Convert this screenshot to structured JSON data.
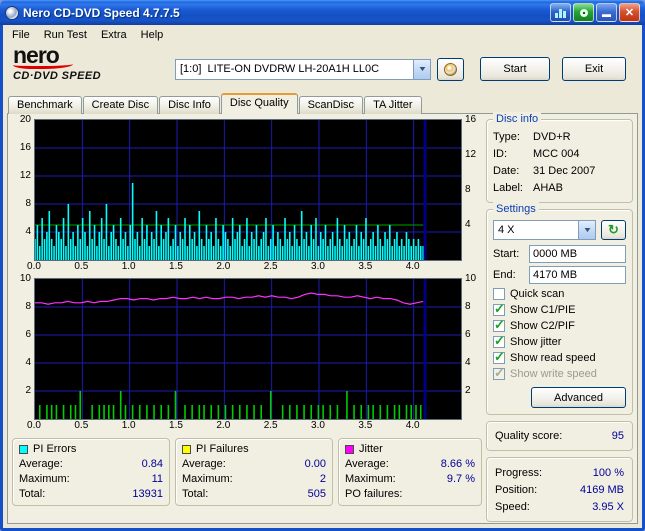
{
  "window": {
    "title": "Nero CD-DVD Speed 4.7.7.5"
  },
  "icons": {
    "minimize_glyph": "▬",
    "close_glyph": "✕",
    "refresh_glyph": "↻",
    "dropdown_glyph": "▼"
  },
  "menu": {
    "items": [
      "File",
      "Run Test",
      "Extra",
      "Help"
    ]
  },
  "logo": {
    "brand": "nero",
    "product": "CD·DVD SPEED"
  },
  "toolbar": {
    "drive_value": "[1:0]  LITE-ON DVDRW LH-20A1H LL0C",
    "start_label": "Start",
    "exit_label": "Exit"
  },
  "tabs": {
    "items": [
      {
        "label": "Benchmark"
      },
      {
        "label": "Create Disc"
      },
      {
        "label": "Disc Info"
      },
      {
        "label": "Disc Quality"
      },
      {
        "label": "ScanDisc"
      },
      {
        "label": "TA Jitter"
      }
    ],
    "active": "Disc Quality"
  },
  "disc_info": {
    "title": "Disc info",
    "rows": [
      {
        "label": "Type:",
        "value": "DVD+R"
      },
      {
        "label": "ID:",
        "value": "MCC 004"
      },
      {
        "label": "Date:",
        "value": "31 Dec 2007"
      },
      {
        "label": "Label:",
        "value": "AHAB"
      }
    ]
  },
  "settings": {
    "title": "Settings",
    "speed_value": "4 X",
    "start_label": "Start:",
    "start_value": "0000 MB",
    "end_label": "End:",
    "end_value": "4170 MB",
    "checkboxes": [
      {
        "label": "Quick scan",
        "checked": false,
        "enabled": true
      },
      {
        "label": "Show C1/PIE",
        "checked": true,
        "enabled": true
      },
      {
        "label": "Show C2/PIF",
        "checked": true,
        "enabled": true
      },
      {
        "label": "Show jitter",
        "checked": true,
        "enabled": true
      },
      {
        "label": "Show read speed",
        "checked": true,
        "enabled": true
      },
      {
        "label": "Show write speed",
        "checked": true,
        "enabled": false
      }
    ],
    "advanced_label": "Advanced"
  },
  "quality": {
    "label": "Quality score:",
    "value": "95"
  },
  "progress": {
    "rows": [
      {
        "label": "Progress:",
        "value": "100 %"
      },
      {
        "label": "Position:",
        "value": "4169 MB"
      },
      {
        "label": "Speed:",
        "value": "3.95 X"
      }
    ]
  },
  "stats": {
    "boxes": [
      {
        "title": "PI Errors",
        "chip": "#00FFFF",
        "rows": [
          {
            "label": "Average:",
            "value": "0.84"
          },
          {
            "label": "Maximum:",
            "value": "11"
          },
          {
            "label": "Total:",
            "value": "13931"
          }
        ]
      },
      {
        "title": "PI Failures",
        "chip": "#FFFF00",
        "rows": [
          {
            "label": "Average:",
            "value": "0.00"
          },
          {
            "label": "Maximum:",
            "value": "2"
          },
          {
            "label": "Total:",
            "value": "505"
          }
        ]
      },
      {
        "title": "Jitter",
        "chip": "#FF00FF",
        "rows": [
          {
            "label": "Average:",
            "value": "8.66 %"
          },
          {
            "label": "Maximum:",
            "value": "9.7 %"
          },
          {
            "label": "PO failures:",
            "value": ""
          }
        ]
      }
    ]
  },
  "chart_data": [
    {
      "type": "bar",
      "title": "PI Errors vs disc position (GB)",
      "x_range": [
        0,
        4.5
      ],
      "x_ticks": [
        "0.0",
        "0.5",
        "1.0",
        "1.5",
        "2.0",
        "2.5",
        "3.0",
        "3.5",
        "4.0"
      ],
      "y_left": {
        "max": 20,
        "ticks": [
          20,
          16,
          12,
          8,
          4
        ],
        "grid": [
          4,
          8,
          12,
          16
        ]
      },
      "y_right": {
        "max": 16,
        "ticks": [
          16,
          12,
          8,
          4
        ]
      },
      "data_end_x": 4.1,
      "bar_color": "#00FFFF",
      "grid_color": "#1B1BB4",
      "read_speed_line": {
        "value": 4,
        "axis": "right",
        "color": "#00A000"
      },
      "end_marker": {
        "x": 4.12,
        "color": "#000080"
      },
      "values": [
        3,
        5,
        2,
        6,
        3,
        4,
        7,
        3,
        2,
        5,
        4,
        3,
        6,
        2,
        8,
        3,
        4,
        2,
        5,
        3,
        6,
        4,
        2,
        7,
        3,
        5,
        2,
        4,
        6,
        3,
        8,
        2,
        4,
        5,
        3,
        2,
        6,
        3,
        4,
        2,
        5,
        11,
        3,
        4,
        2,
        6,
        3,
        5,
        2,
        4,
        3,
        7,
        2,
        5,
        3,
        4,
        6,
        2,
        3,
        5,
        2,
        4,
        3,
        6,
        2,
        5,
        3,
        4,
        2,
        7,
        3,
        2,
        5,
        3,
        4,
        2,
        6,
        3,
        2,
        5,
        4,
        3,
        2,
        6,
        3,
        4,
        5,
        2,
        3,
        6,
        2,
        4,
        3,
        5,
        2,
        3,
        4,
        6,
        2,
        3,
        5,
        2,
        4,
        3,
        2,
        6,
        3,
        4,
        2,
        5,
        3,
        2,
        7,
        3,
        4,
        2,
        5,
        3,
        6,
        2,
        4,
        3,
        5,
        2,
        3,
        4,
        2,
        6,
        3,
        2,
        5,
        3,
        4,
        2,
        3,
        5,
        2,
        4,
        3,
        6,
        2,
        3,
        4,
        2,
        5,
        3,
        2,
        4,
        3,
        5,
        2,
        3,
        4,
        2,
        3,
        2,
        4,
        3,
        2,
        3,
        2,
        3,
        2,
        2
      ]
    },
    {
      "type": "line+bar",
      "title": "Jitter (%) and PI Failures vs disc position (GB)",
      "x_range": [
        0,
        4.5
      ],
      "x_ticks": [
        "0.0",
        "0.5",
        "1.0",
        "1.5",
        "2.0",
        "2.5",
        "3.0",
        "3.5",
        "4.0"
      ],
      "y_left": {
        "max": 10,
        "ticks": [
          10,
          8,
          6,
          4,
          2
        ],
        "grid": [
          2,
          4,
          6,
          8
        ]
      },
      "y_right": {
        "max": 10,
        "ticks": [
          10,
          8,
          6,
          4,
          2
        ]
      },
      "data_end_x": 4.1,
      "grid_color": "#1B1BB4",
      "end_marker": {
        "x": 4.12,
        "color": "#000080"
      },
      "jitter_line": {
        "color": "#FF30FF",
        "values": [
          8.3,
          8.3,
          8.2,
          8.3,
          8.3,
          8.4,
          8.3,
          8.3,
          8.4,
          8.3,
          8.4,
          8.4,
          8.5,
          8.6,
          8.6,
          8.5,
          8.6,
          8.6,
          8.5,
          8.6,
          8.6,
          8.7,
          8.6,
          8.6,
          8.7,
          8.6,
          8.7,
          8.6,
          8.6,
          8.7,
          8.7,
          8.6,
          8.7,
          8.7,
          8.8,
          8.7,
          8.8,
          8.7,
          8.7,
          8.6,
          8.7,
          8.9,
          9.0,
          8.9,
          8.9,
          8.8,
          8.8,
          8.7,
          8.7,
          8.8,
          8.7,
          8.6,
          8.7,
          8.6,
          8.6,
          8.5,
          8.3,
          8.2,
          8.3,
          8.4
        ]
      },
      "pif_bars": {
        "color": "#00CC00",
        "n": 164,
        "points": [
          [
            2,
            1
          ],
          [
            5,
            1
          ],
          [
            7,
            1
          ],
          [
            9,
            1
          ],
          [
            12,
            1
          ],
          [
            15,
            1
          ],
          [
            17,
            1
          ],
          [
            19,
            2
          ],
          [
            24,
            1
          ],
          [
            27,
            1
          ],
          [
            29,
            1
          ],
          [
            31,
            1
          ],
          [
            33,
            1
          ],
          [
            36,
            2
          ],
          [
            38,
            1
          ],
          [
            41,
            1
          ],
          [
            44,
            1
          ],
          [
            47,
            1
          ],
          [
            50,
            1
          ],
          [
            53,
            1
          ],
          [
            56,
            1
          ],
          [
            59,
            2
          ],
          [
            63,
            1
          ],
          [
            66,
            1
          ],
          [
            69,
            1
          ],
          [
            71,
            1
          ],
          [
            74,
            1
          ],
          [
            77,
            1
          ],
          [
            80,
            1
          ],
          [
            83,
            1
          ],
          [
            86,
            1
          ],
          [
            89,
            1
          ],
          [
            92,
            1
          ],
          [
            95,
            1
          ],
          [
            99,
            2
          ],
          [
            104,
            1
          ],
          [
            107,
            1
          ],
          [
            110,
            1
          ],
          [
            113,
            1
          ],
          [
            116,
            1
          ],
          [
            119,
            1
          ],
          [
            121,
            1
          ],
          [
            124,
            1
          ],
          [
            127,
            1
          ],
          [
            131,
            2
          ],
          [
            134,
            1
          ],
          [
            137,
            1
          ],
          [
            140,
            1
          ],
          [
            142,
            1
          ],
          [
            145,
            1
          ],
          [
            148,
            1
          ],
          [
            151,
            1
          ],
          [
            153,
            1
          ],
          [
            156,
            1
          ],
          [
            158,
            1
          ],
          [
            160,
            1
          ],
          [
            162,
            1
          ]
        ]
      }
    }
  ]
}
